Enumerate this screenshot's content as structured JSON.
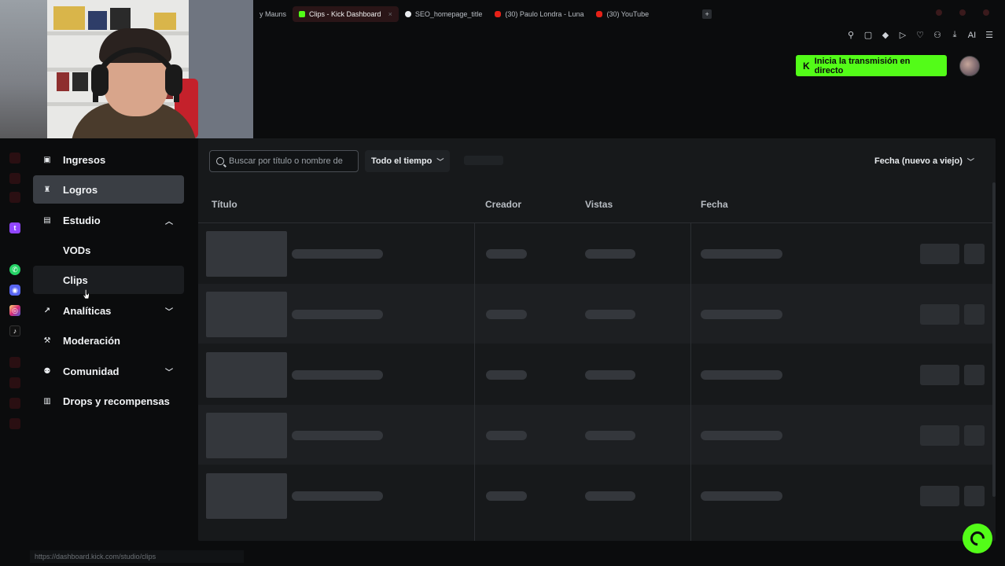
{
  "browser": {
    "tabs": [
      {
        "label": "y Mauns",
        "icon": "kick-icon",
        "active": false
      },
      {
        "label": "Clips - Kick Dashboard",
        "icon": "kick-icon",
        "active": true
      },
      {
        "label": "SEO_homepage_title",
        "icon": "tiktok-icon",
        "active": false
      },
      {
        "label": "(30) Paulo Londra - Luna",
        "icon": "youtube-icon",
        "active": false
      },
      {
        "label": "(30) YouTube",
        "icon": "youtube-icon",
        "active": false
      }
    ],
    "new_tab": "+",
    "toolbar_ai_label": "AI",
    "status_url": "https://dashboard.kick.com/studio/clips"
  },
  "topbar": {
    "go_live_label": "Inicia la transmisión en directo",
    "go_live_icon": "kick-logo-icon",
    "accent": "#53fc18"
  },
  "sidebar": {
    "items": [
      {
        "label": "Ingresos",
        "icon": "wallet-icon",
        "active": false
      },
      {
        "label": "Logros",
        "icon": "trophy-icon",
        "active": true
      },
      {
        "label": "Estudio",
        "icon": "film-icon",
        "expanded": true
      },
      {
        "label": "VODs"
      },
      {
        "label": "Clips",
        "hover": true
      },
      {
        "label": "Analíticas",
        "icon": "chart-icon",
        "expanded": false
      },
      {
        "label": "Moderación",
        "icon": "hammer-icon"
      },
      {
        "label": "Comunidad",
        "icon": "people-icon",
        "expanded": false
      },
      {
        "label": "Drops y recompensas",
        "icon": "gift-icon"
      }
    ]
  },
  "clips": {
    "search_placeholder": "Buscar por título o nombre de",
    "time_filter": "Todo el tiempo",
    "sort": "Fecha (nuevo a viejo)",
    "columns": [
      "Título",
      "Creador",
      "Vistas",
      "Fecha"
    ],
    "loading_rows": 5
  }
}
